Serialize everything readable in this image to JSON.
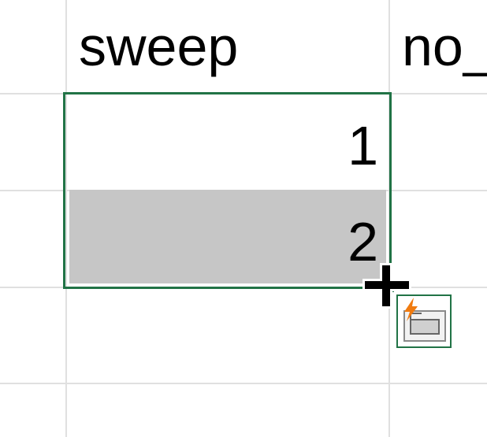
{
  "sheet": {
    "headers": {
      "col_b": "sweep",
      "col_c": "no_"
    },
    "rows": [
      {
        "col_b": "1"
      },
      {
        "col_b": "2"
      }
    ]
  },
  "colors": {
    "gridline": "#e0e0e0",
    "selection_border": "#217346",
    "selected_range_fill": "#c6c6c6",
    "autofill_bolt": "#f07b10"
  },
  "icons": {
    "cursor": "crosshair-plus-icon",
    "autofill_options": "auto-fill-options-icon"
  }
}
